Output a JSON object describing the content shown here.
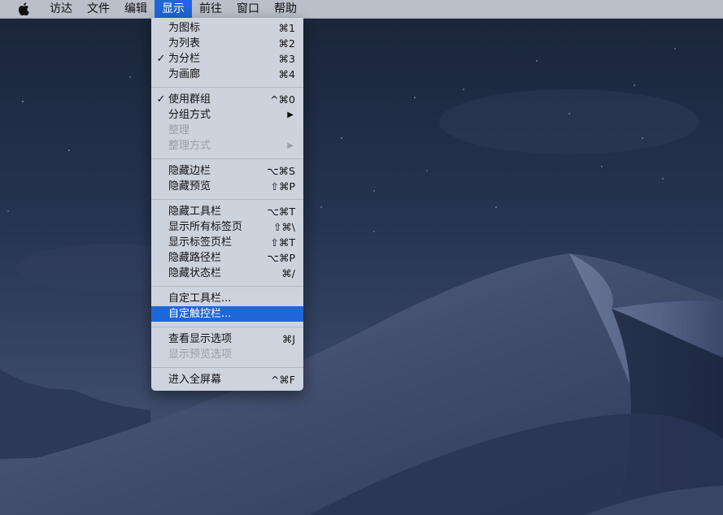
{
  "menubar": {
    "apple_icon": "apple-logo-icon",
    "items": [
      {
        "label": "访达",
        "active": false
      },
      {
        "label": "文件",
        "active": false
      },
      {
        "label": "编辑",
        "active": false
      },
      {
        "label": "显示",
        "active": true
      },
      {
        "label": "前往",
        "active": false
      },
      {
        "label": "窗口",
        "active": false
      },
      {
        "label": "帮助",
        "active": false
      }
    ]
  },
  "view_menu": {
    "items": [
      {
        "label": "为图标",
        "shortcut": "⌘1",
        "checked": false,
        "enabled": true
      },
      {
        "label": "为列表",
        "shortcut": "⌘2",
        "checked": false,
        "enabled": true
      },
      {
        "label": "为分栏",
        "shortcut": "⌘3",
        "checked": true,
        "enabled": true
      },
      {
        "label": "为画廊",
        "shortcut": "⌘4",
        "checked": false,
        "enabled": true
      },
      {
        "label": "使用群组",
        "shortcut": "^⌘0",
        "checked": true,
        "enabled": true
      },
      {
        "label": "分组方式",
        "submenu": true,
        "enabled": true
      },
      {
        "label": "整理",
        "enabled": false
      },
      {
        "label": "整理方式",
        "submenu": true,
        "enabled": false
      },
      {
        "label": "隐藏边栏",
        "shortcut": "⌥⌘S",
        "enabled": true
      },
      {
        "label": "隐藏预览",
        "shortcut": "⇧⌘P",
        "enabled": true
      },
      {
        "label": "隐藏工具栏",
        "shortcut": "⌥⌘T",
        "enabled": true
      },
      {
        "label": "显示所有标签页",
        "shortcut": "⇧⌘\\",
        "enabled": true
      },
      {
        "label": "显示标签页栏",
        "shortcut": "⇧⌘T",
        "enabled": true
      },
      {
        "label": "隐藏路径栏",
        "shortcut": "⌥⌘P",
        "enabled": true
      },
      {
        "label": "隐藏状态栏",
        "shortcut": "⌘/",
        "enabled": true
      },
      {
        "label": "自定工具栏...",
        "enabled": true
      },
      {
        "label": "自定触控栏...",
        "enabled": true,
        "highlighted": true
      },
      {
        "label": "查看显示选项",
        "shortcut": "⌘J",
        "enabled": true
      },
      {
        "label": "显示预览选项",
        "enabled": false
      },
      {
        "label": "进入全屏幕",
        "shortcut": "^⌘F",
        "enabled": true
      }
    ],
    "check_glyph": "✓",
    "submenu_glyph": "▶"
  },
  "colors": {
    "highlight": "#1f66d8",
    "menu_bg": "#d4dae3",
    "disabled_text": "#9aa0a8"
  }
}
